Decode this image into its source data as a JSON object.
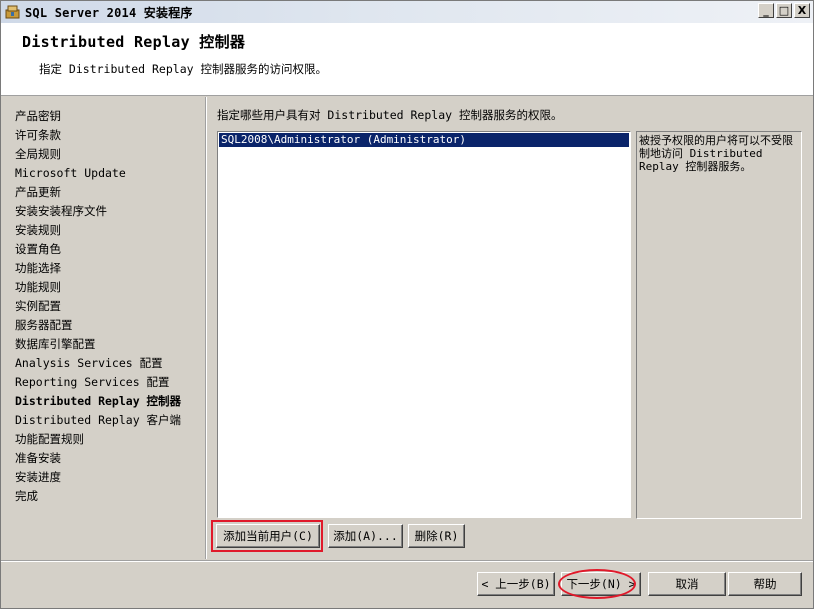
{
  "window": {
    "title": "SQL Server 2014 安装程序",
    "minimize_glyph": "_",
    "maximize_glyph": "□",
    "close_glyph": "X",
    "icon": "sql-server-setup-icon"
  },
  "header": {
    "title": "Distributed Replay 控制器",
    "subtitle": "指定 Distributed Replay 控制器服务的访问权限。"
  },
  "sidebar": {
    "items": [
      {
        "label": "产品密钥"
      },
      {
        "label": "许可条款"
      },
      {
        "label": "全局规则"
      },
      {
        "label": "Microsoft Update"
      },
      {
        "label": "产品更新"
      },
      {
        "label": "安装安装程序文件"
      },
      {
        "label": "安装规则"
      },
      {
        "label": "设置角色"
      },
      {
        "label": "功能选择"
      },
      {
        "label": "功能规则"
      },
      {
        "label": "实例配置"
      },
      {
        "label": "服务器配置"
      },
      {
        "label": "数据库引擎配置"
      },
      {
        "label": "Analysis Services 配置"
      },
      {
        "label": "Reporting Services 配置"
      },
      {
        "label": "Distributed Replay 控制器",
        "active": true
      },
      {
        "label": "Distributed Replay 客户端"
      },
      {
        "label": "功能配置规则"
      },
      {
        "label": "准备安装"
      },
      {
        "label": "安装进度"
      },
      {
        "label": "完成"
      }
    ]
  },
  "main": {
    "instruction": "指定哪些用户具有对 Distributed Replay 控制器服务的权限。",
    "users": [
      "SQL2008\\Administrator (Administrator)"
    ],
    "description": "被授予权限的用户将可以不受限制地访问 Distributed Replay 控制器服务。",
    "add_current_user_label": "添加当前用户(C)",
    "add_label": "添加(A)...",
    "remove_label": "删除(R)"
  },
  "footer": {
    "back_label": "< 上一步(B)",
    "next_label": "下一步(N) >",
    "cancel_label": "取消",
    "help_label": "帮助"
  },
  "colors": {
    "selection": "#0a246a",
    "highlight": "#e0192a",
    "face": "#d4d0c8"
  }
}
